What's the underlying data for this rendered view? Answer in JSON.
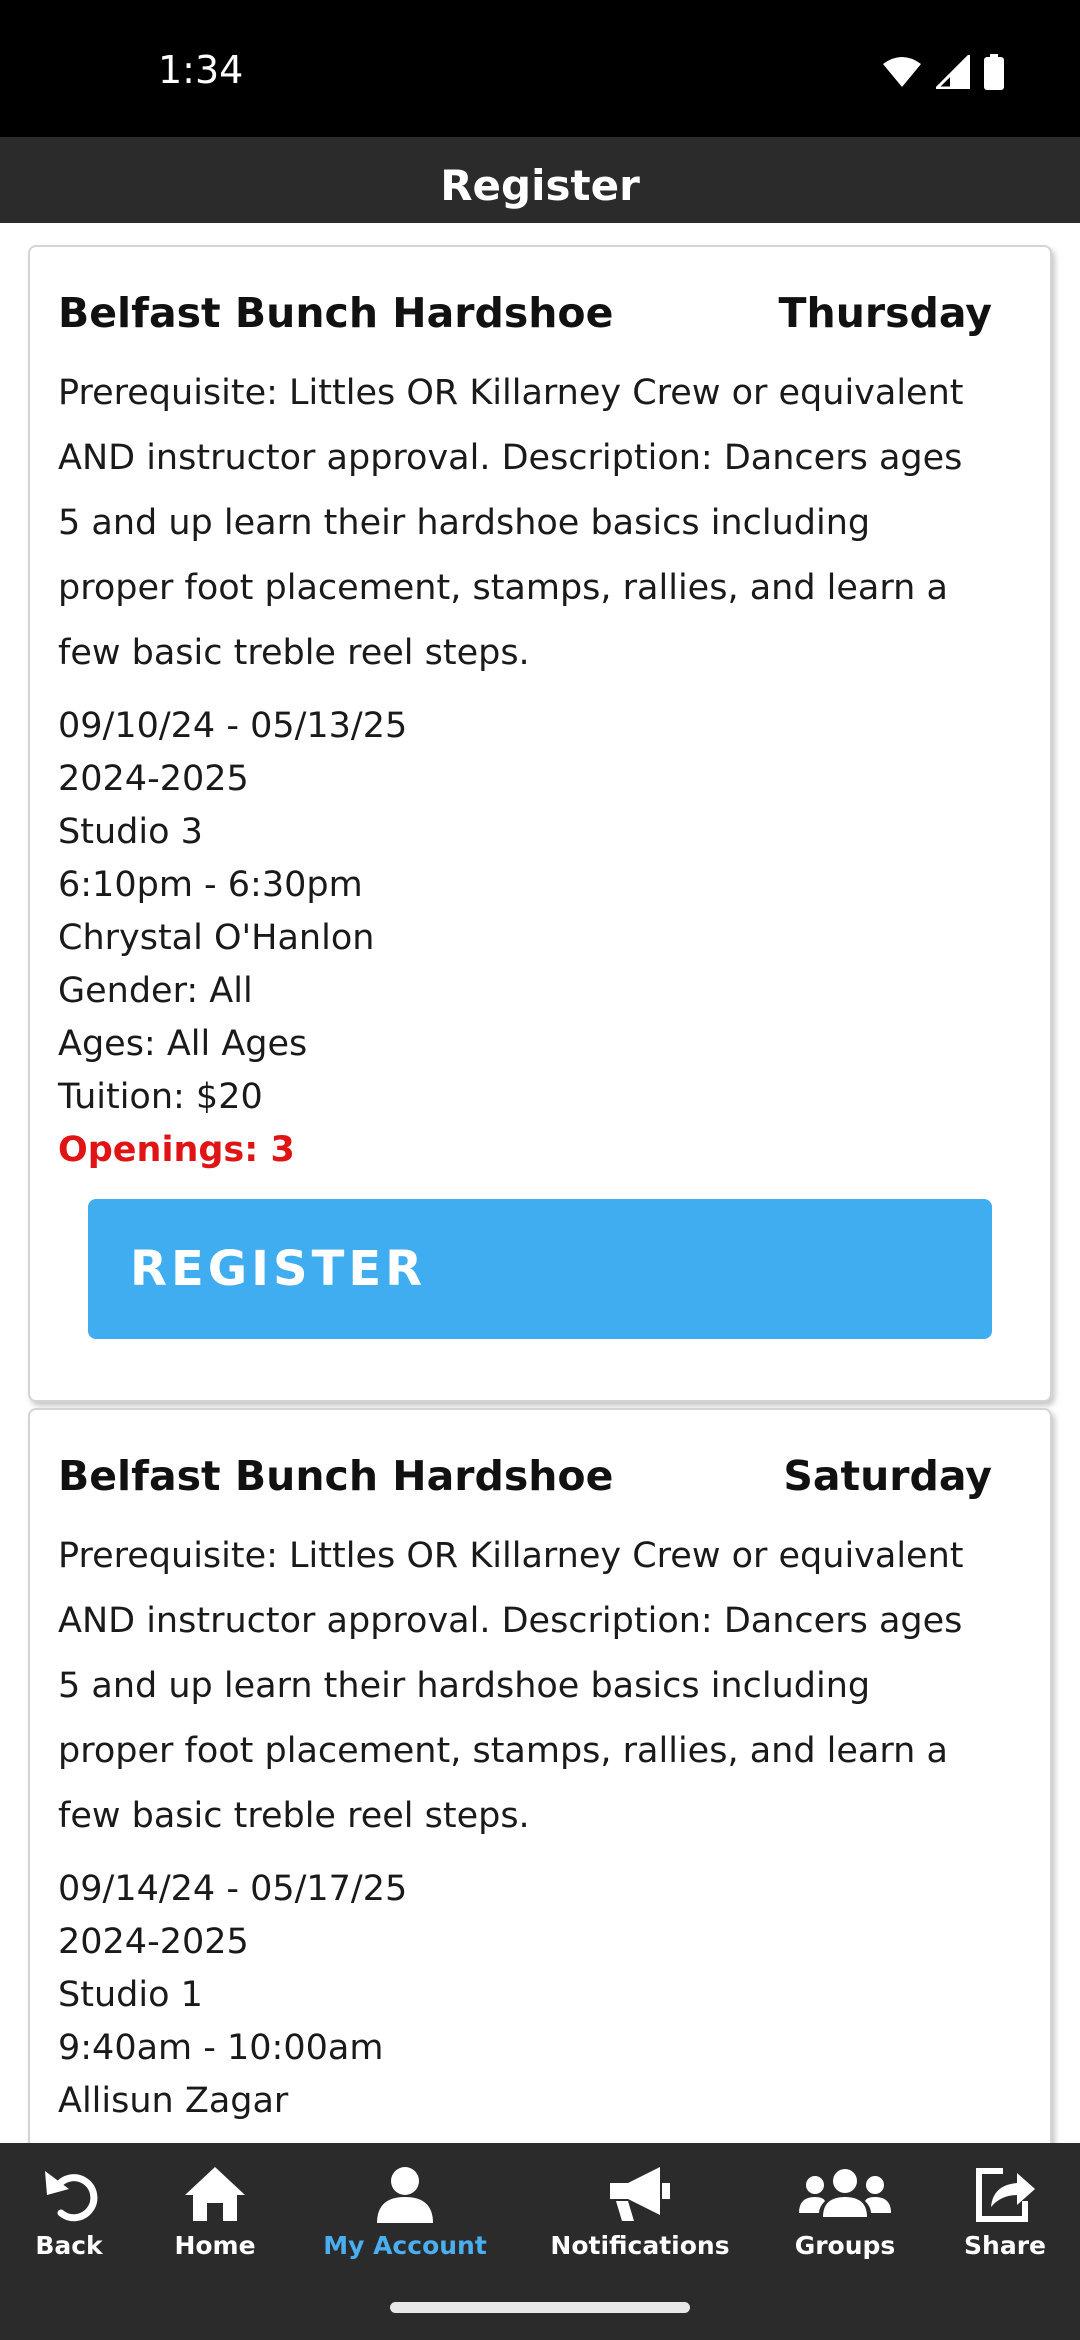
{
  "status_bar": {
    "time": "1:34",
    "icons": [
      "wifi-icon",
      "signal-icon",
      "battery-icon"
    ]
  },
  "header": {
    "title": "Register"
  },
  "classes": [
    {
      "name": "Belfast Bunch Hardshoe",
      "day": "Thursday",
      "description": "Prerequisite: Littles OR Killarney Crew or equivalent AND instructor approval. Description: Dancers ages 5 and up learn their hardshoe basics including proper foot placement, stamps, rallies, and learn a few basic treble reel steps.",
      "dates": "09/10/24 - 05/13/25",
      "season": "2024-2025",
      "location": "Studio 3",
      "time": "6:10pm - 6:30pm",
      "instructor": "Chrystal O'Hanlon",
      "gender": "Gender: All",
      "ages": "Ages: All Ages",
      "tuition": "Tuition: $20",
      "openings": "Openings: 3",
      "button_label": "REGISTER"
    },
    {
      "name": "Belfast Bunch Hardshoe",
      "day": "Saturday",
      "description": "Prerequisite: Littles OR Killarney Crew or equivalent AND instructor approval. Description: Dancers ages 5 and up learn their hardshoe basics including proper foot placement, stamps, rallies, and learn a few basic treble reel steps.",
      "dates": "09/14/24 - 05/17/25",
      "season": "2024-2025",
      "location": "Studio 1",
      "time": "9:40am - 10:00am",
      "instructor": "Allisun Zagar"
    }
  ],
  "bottom_nav": [
    {
      "label": "Back",
      "icon": "undo-icon",
      "active": false
    },
    {
      "label": "Home",
      "icon": "home-icon",
      "active": false
    },
    {
      "label": "My Account",
      "icon": "user-icon",
      "active": true
    },
    {
      "label": "Notifications",
      "icon": "megaphone-icon",
      "active": false
    },
    {
      "label": "Groups",
      "icon": "group-icon",
      "active": false
    },
    {
      "label": "Share",
      "icon": "share-icon",
      "active": false
    }
  ],
  "colors": {
    "header_bg": "#2b2b2b",
    "accent": "#3fadf0",
    "active_nav": "#4aaef0",
    "openings": "#e01414"
  }
}
